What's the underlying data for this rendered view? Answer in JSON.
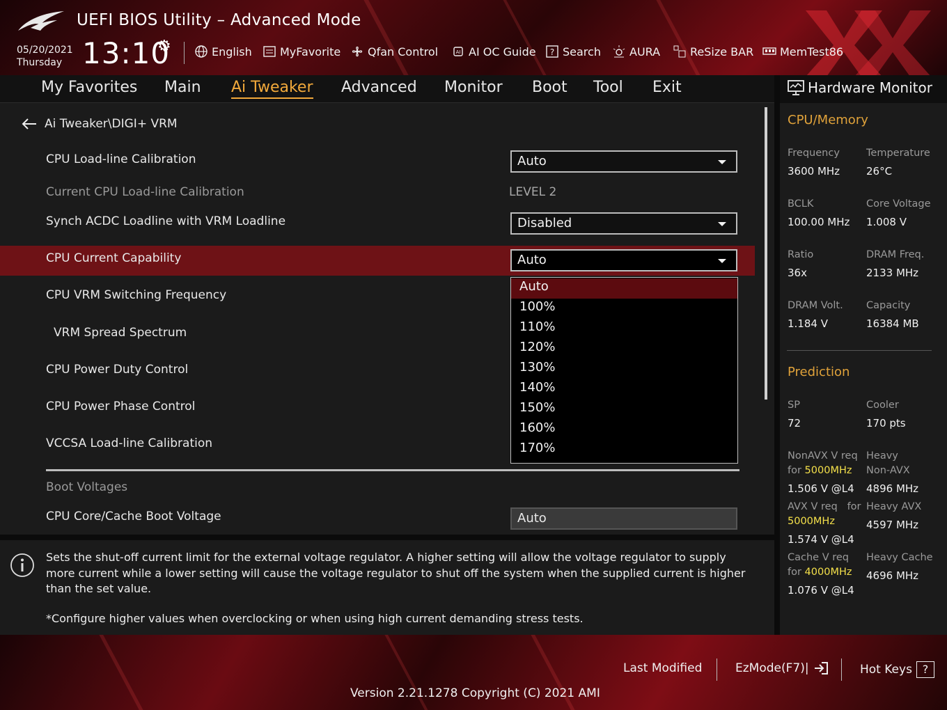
{
  "header": {
    "app_title": "UEFI BIOS Utility – Advanced Mode",
    "date": "05/20/2021",
    "day": "Thursday",
    "time": "13:10",
    "tools": [
      {
        "label": "English",
        "icon": "globe-icon"
      },
      {
        "label": "MyFavorite",
        "icon": "favorite-list-icon"
      },
      {
        "label": "Qfan Control",
        "icon": "fan-icon"
      },
      {
        "label": "AI OC Guide",
        "icon": "ai-chip-icon"
      },
      {
        "label": "Search",
        "icon": "search-help-icon"
      },
      {
        "label": "AURA",
        "icon": "aura-light-icon"
      },
      {
        "label": "ReSize BAR",
        "icon": "resize-bar-icon"
      },
      {
        "label": "MemTest86",
        "icon": "memory-icon"
      }
    ]
  },
  "nav": {
    "tabs": [
      "My Favorites",
      "Main",
      "Ai Tweaker",
      "Advanced",
      "Monitor",
      "Boot",
      "Tool",
      "Exit"
    ],
    "active": "Ai Tweaker"
  },
  "main": {
    "breadcrumb": "Ai Tweaker\\DIGI+ VRM",
    "rows": {
      "cpu_llc": {
        "label": "CPU Load-line Calibration",
        "value": "Auto"
      },
      "current_cpu_llc": {
        "label": "Current CPU Load-line Calibration",
        "value": "LEVEL 2"
      },
      "synch_acdc": {
        "label": "Synch ACDC Loadline with VRM Loadline",
        "value": "Disabled"
      },
      "cpu_current_capability": {
        "label": "CPU Current Capability",
        "value": "Auto"
      },
      "cpu_vrm_switching_frequency": {
        "label": "CPU VRM Switching Frequency"
      },
      "vrm_spread_spectrum": {
        "label": "VRM Spread Spectrum"
      },
      "cpu_power_duty_control": {
        "label": "CPU Power Duty Control"
      },
      "cpu_power_phase_control": {
        "label": "CPU Power Phase Control"
      },
      "vccsa_llc": {
        "label": "VCCSA Load-line Calibration"
      }
    },
    "boot_voltages_heading": "Boot Voltages",
    "cpu_core_cache_boot_voltage": {
      "label": "CPU Core/Cache Boot Voltage",
      "value": "Auto"
    },
    "dropdown_options": [
      "Auto",
      "100%",
      "110%",
      "120%",
      "130%",
      "140%",
      "150%",
      "160%",
      "170%"
    ],
    "dropdown_selected": "Auto"
  },
  "help": {
    "text": "Sets the shut-off current limit for the external voltage regulator. A higher setting will allow the voltage regulator to supply more current while a lower setting will cause the voltage regulator to shut off the system when the supplied current is higher than the set value.",
    "note": "*Configure higher values when overclocking or when using high current demanding stress tests."
  },
  "hw_monitor": {
    "title": "Hardware Monitor",
    "cpu_memory_heading": "CPU/Memory",
    "frequency": {
      "label": "Frequency",
      "value": "3600 MHz"
    },
    "temperature": {
      "label": "Temperature",
      "value": "26°C"
    },
    "bclk": {
      "label": "BCLK",
      "value": "100.00 MHz"
    },
    "core_voltage": {
      "label": "Core Voltage",
      "value": "1.008 V"
    },
    "ratio": {
      "label": "Ratio",
      "value": "36x"
    },
    "dram_freq": {
      "label": "DRAM Freq.",
      "value": "2133 MHz"
    },
    "dram_volt": {
      "label": "DRAM Volt.",
      "value": "1.184 V"
    },
    "capacity": {
      "label": "Capacity",
      "value": "16384 MB"
    },
    "prediction_heading": "Prediction",
    "sp": {
      "label": "SP",
      "value": "72"
    },
    "cooler": {
      "label": "Cooler",
      "value": "170 pts"
    },
    "nonavx_req": {
      "label_line1": "NonAVX V req",
      "label_for": "for ",
      "freq": "5000MHz",
      "value": "1.506 V @L4"
    },
    "heavy_nonavx": {
      "label_line1": "Heavy",
      "label_line2": "Non-AVX",
      "value": "4896 MHz"
    },
    "avx_req": {
      "label_line1": "AVX V req",
      "label_for": "for",
      "freq": "5000MHz",
      "value": "1.574 V @L4"
    },
    "heavy_avx": {
      "label": "Heavy AVX",
      "value": "4597 MHz"
    },
    "cache_req": {
      "label_line1": "Cache V req",
      "label_for": "for ",
      "freq": "4000MHz",
      "value": "1.076 V @L4"
    },
    "heavy_cache": {
      "label": "Heavy Cache",
      "value": "4696 MHz"
    }
  },
  "footer": {
    "last_modified": "Last Modified",
    "ezmode": "EzMode(F7)|",
    "hot_keys": "Hot Keys",
    "hot_keys_key": "?",
    "version": "Version 2.21.1278 Copyright (C) 2021 AMI"
  },
  "colors": {
    "accent": "#f2a93b",
    "selection_row": "#6e1216",
    "highlight_freq": "#f4e04a"
  }
}
